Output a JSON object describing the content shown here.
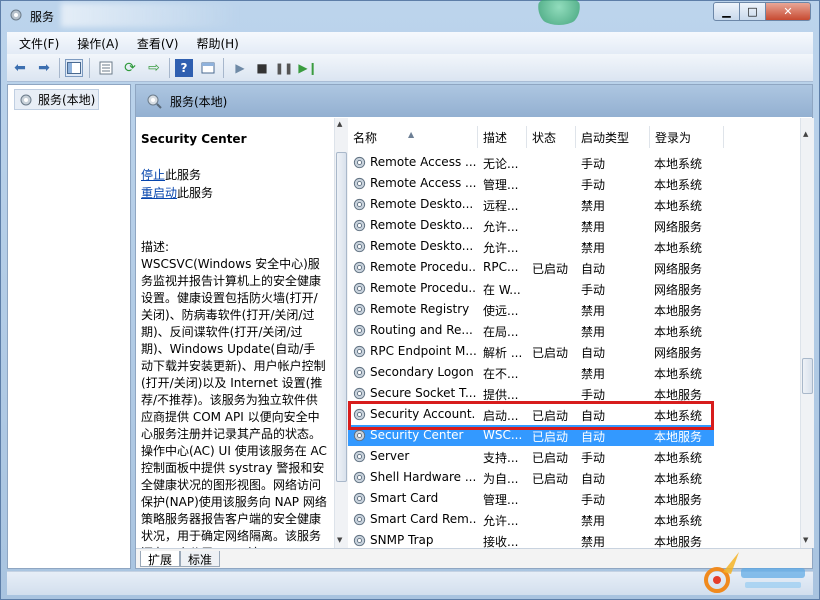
{
  "window": {
    "title": "服务"
  },
  "menu": [
    "文件(F)",
    "操作(A)",
    "查看(V)",
    "帮助(H)"
  ],
  "tree": {
    "root": "服务(本地)"
  },
  "header": {
    "title": "服务(本地)"
  },
  "detail": {
    "service_name": "Security Center",
    "stop_link": "停止",
    "stop_suffix": "此服务",
    "restart_link": "重启动",
    "restart_suffix": "此服务",
    "desc_label": "描述:",
    "description": "WSCSVC(Windows 安全中心)服务监视并报告计算机上的安全健康设置。健康设置包括防火墙(打开/关闭)、防病毒软件(打开/关闭/过期)、反间谍软件(打开/关闭/过期)、Windows Update(自动/手动下载并安装更新)、用户帐户控制(打开/关闭)以及 Internet 设置(推荐/不推荐)。该服务为独立软件供应商提供 COM API 以便向安全中心服务注册并记录其产品的状态。操作中心(AC) UI 使用该服务在 AC 控制面板中提供 systray 警报和安全健康状况的图形视图。网络访问保护(NAP)使用该服务向 NAP 网络策略服务器报告客户端的安全健康状况，用于确定网络隔离。该服务还有一个公用 API，该"
  },
  "columns": [
    "名称",
    "描述",
    "状态",
    "启动类型",
    "登录为"
  ],
  "rows": [
    {
      "name": "Remote Access ...",
      "desc": "无论...",
      "status": "",
      "startup": "手动",
      "logon": "本地系统"
    },
    {
      "name": "Remote Access ...",
      "desc": "管理...",
      "status": "",
      "startup": "手动",
      "logon": "本地系统"
    },
    {
      "name": "Remote Deskto...",
      "desc": "远程...",
      "status": "",
      "startup": "禁用",
      "logon": "本地系统"
    },
    {
      "name": "Remote Deskto...",
      "desc": "允许...",
      "status": "",
      "startup": "禁用",
      "logon": "网络服务"
    },
    {
      "name": "Remote Deskto...",
      "desc": "允许...",
      "status": "",
      "startup": "禁用",
      "logon": "本地系统"
    },
    {
      "name": "Remote Procedu...",
      "desc": "RPC...",
      "status": "已启动",
      "startup": "自动",
      "logon": "网络服务"
    },
    {
      "name": "Remote Procedu...",
      "desc": "在 W...",
      "status": "",
      "startup": "手动",
      "logon": "网络服务"
    },
    {
      "name": "Remote Registry",
      "desc": "使远...",
      "status": "",
      "startup": "禁用",
      "logon": "本地服务"
    },
    {
      "name": "Routing and Re...",
      "desc": "在局...",
      "status": "",
      "startup": "禁用",
      "logon": "本地系统"
    },
    {
      "name": "RPC Endpoint M...",
      "desc": "解析 ...",
      "status": "已启动",
      "startup": "自动",
      "logon": "网络服务"
    },
    {
      "name": "Secondary Logon",
      "desc": "在不...",
      "status": "",
      "startup": "禁用",
      "logon": "本地系统"
    },
    {
      "name": "Secure Socket T...",
      "desc": "提供...",
      "status": "",
      "startup": "手动",
      "logon": "本地服务"
    },
    {
      "name": "Security Account...",
      "desc": "启动...",
      "status": "已启动",
      "startup": "自动",
      "logon": "本地系统"
    },
    {
      "name": "Security Center",
      "desc": "WSC...",
      "status": "已启动",
      "startup": "自动",
      "logon": "本地服务",
      "selected": true
    },
    {
      "name": "Server",
      "desc": "支持...",
      "status": "已启动",
      "startup": "手动",
      "logon": "本地系统"
    },
    {
      "name": "Shell Hardware ...",
      "desc": "为自...",
      "status": "已启动",
      "startup": "自动",
      "logon": "本地系统"
    },
    {
      "name": "Smart Card",
      "desc": "管理...",
      "status": "",
      "startup": "手动",
      "logon": "本地服务"
    },
    {
      "name": "Smart Card Rem...",
      "desc": "允许...",
      "status": "",
      "startup": "禁用",
      "logon": "本地系统"
    },
    {
      "name": "SNMP Trap",
      "desc": "接收...",
      "status": "",
      "startup": "禁用",
      "logon": "本地服务"
    }
  ],
  "tabs": [
    "扩展",
    "标准"
  ],
  "colors": {
    "selection": "#3399ff",
    "highlight_border": "#d71c1c"
  }
}
